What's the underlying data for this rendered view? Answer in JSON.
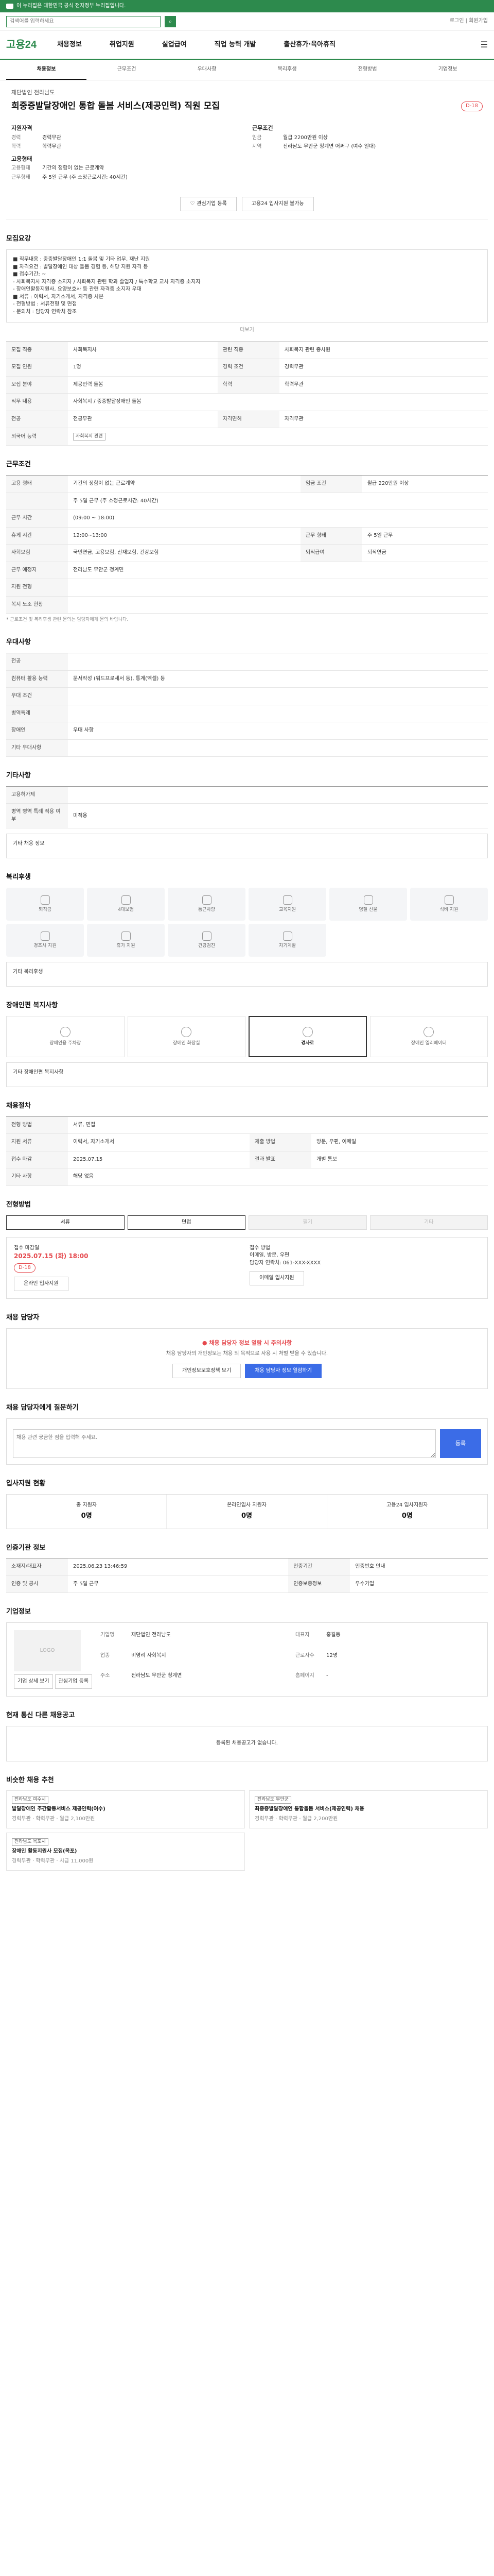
{
  "topbar": {
    "text": "이 누리집은 대한민국 공식 전자정부 누리집입니다."
  },
  "util": {
    "search_placeholder": "검색어를 입력하세요",
    "right": "로그인 | 회원가입"
  },
  "gnb": {
    "logo": "고용24",
    "menu": [
      "채용정보",
      "취업지원",
      "실업급여",
      "직업 능력 개발",
      "출산휴가·육아휴직"
    ]
  },
  "tabs": [
    "채용정보",
    "근무조건",
    "우대사항",
    "복리후생",
    "전형방법",
    "기업정보"
  ],
  "hero": {
    "org": "재단법인 전라남도",
    "title": "희중증발달장애인 통합 돌봄 서비스(제공인력) 직원 모집",
    "dday": "D-18",
    "qualify_h": "지원자격",
    "career_k": "경력",
    "career_v": "경력무관",
    "edu_k": "학력",
    "edu_v": "학력무관",
    "cond_h": "근무조건",
    "pay_k": "임금",
    "pay_v": "월급 2200만원 이상",
    "loc_k": "지역",
    "loc_v": "전라남도 무안군 청계면 어쩌구 (여수 일대)",
    "type_h": "고용형태",
    "type_k": "고용형태",
    "type_v": "기간의 정함이 없는 근로계약",
    "time_k": "근무형태",
    "time_v": "주 5일 근무 (주 소정근로시간: 40시간)",
    "btn_interest": "관심기업 등록",
    "btn_share": "고용24 입사지원 불가능"
  },
  "job_section": {
    "title": "모집요강",
    "body": "■ 직무내용 : 중증발달장애인 1:1 돌봄 및 기타 업무, 재난 지원",
    "lines": [
      "■ 자격요건 : 발달장애인 대상 돌봄 경험 등, 해당 지원 자격 등",
      "■ 접수기간: ~",
      "- 사회복지사 자격증 소지자 / 사회복지 관련 학과 졸업자 / 특수학교 교사 자격증 소지자",
      "- 장애인활동지원사, 요양보호사 등 관련 자격증 소지자 우대",
      "■ 서류 : 이력서, 자기소개서, 자격증 사본",
      "- 전형방법 : 서류전형 및 면접",
      "- 문의처 : 담당자 연락처 참조"
    ],
    "more": "더보기"
  },
  "job_table": [
    {
      "k1": "모집 직종",
      "v1": "사회복지사",
      "k2": "관련 직종",
      "v2": "사회복지 관련 종사원"
    },
    {
      "k1": "모집 인원",
      "v1": "1명",
      "k2": "경력 조건",
      "v2": "경력무관"
    },
    {
      "k1": "모집 분야",
      "v1": "제공인력 돌봄",
      "k2": "학력",
      "v2": "학력무관"
    },
    {
      "k1": "직무 내용",
      "v1": "사회복지 / 중증발달장애인 돌봄",
      "k2": "",
      "v2": ""
    },
    {
      "k1": "전공",
      "v1": "전공무관",
      "k2": "자격면허",
      "v2": "자격무관"
    },
    {
      "k1": "외국어 능력",
      "v1": "",
      "k2": "",
      "v2": ""
    }
  ],
  "job_tag": "사회복지 관련",
  "work_section": {
    "title": "근무조건"
  },
  "work_table": [
    {
      "k1": "고용 형태",
      "v1": "기간의 정함이 없는 근로계약",
      "k2": "임금 조건",
      "v2": "월급 220만원 이상"
    },
    {
      "k1": "",
      "v1": "주 5일 근무 (주 소정근로시간: 40시간)",
      "k2": "",
      "v2": ""
    },
    {
      "k1": "근무 시간",
      "v1": "(09:00 ~ 18:00)",
      "k2": "",
      "v2": ""
    },
    {
      "k1": "휴게 시간",
      "v1": "12:00~13:00",
      "k2": "근무 형태",
      "v2": "주 5일 근무"
    },
    {
      "k1": "사회보험",
      "v1": "국민연금, 고용보험, 산재보험, 건강보험",
      "k2": "퇴직급여",
      "v2": "퇴직연금"
    },
    {
      "k1": "근무 예정지",
      "v1": "전라남도 무안군 청계면",
      "k2": "",
      "v2": ""
    },
    {
      "k1": "지원 전형",
      "v1": "",
      "k2": "",
      "v2": ""
    },
    {
      "k1": "복지 노조 현황",
      "v1": "",
      "k2": "",
      "v2": ""
    }
  ],
  "work_note": "* 근로조건 및 복리후생 관련 문의는 담당자에게 문의 바랍니다.",
  "pref_section": {
    "title": "우대사항"
  },
  "pref_table": [
    {
      "k": "전공",
      "v": ""
    },
    {
      "k": "컴퓨터 활용 능력",
      "v": "문서작성 (워드프로세서 등), 통계(엑셀) 등"
    },
    {
      "k": "우대 조건",
      "v": ""
    },
    {
      "k": "병역특례",
      "v": ""
    },
    {
      "k": "장애인",
      "v": "우대 사항"
    },
    {
      "k": "기타 우대사항",
      "v": ""
    }
  ],
  "other_section": {
    "title": "기타사항"
  },
  "other_table": [
    {
      "k": "고용허가제",
      "v": ""
    },
    {
      "k": "병역 병역 특례 적용 여부",
      "v": "미적용"
    }
  ],
  "other_note": "기타 채용 정보",
  "welfare_section": {
    "title": "복리후생"
  },
  "welfare": [
    "퇴직금",
    "4대보험",
    "통근차량",
    "교육지원",
    "명절 선물",
    "식비 지원",
    "경조사 지원",
    "휴가 지원",
    "건강검진",
    "자기계발"
  ],
  "welfare_note": "기타 복리후생",
  "disability_section": {
    "title": "장애인편 복지사항"
  },
  "disability": [
    "장애인용 주차장",
    "장애인 화장실",
    "경사로",
    "장애인 엘리베이터"
  ],
  "disability_note": "기타 장애인편 복지사항",
  "recruit_section": {
    "title": "채용절차"
  },
  "recruit_table": [
    {
      "k1": "전형 방법",
      "v1": "서류, 면접",
      "k2": "",
      "v2": ""
    },
    {
      "k1": "지원 서류",
      "v1": "이력서, 자기소개서",
      "k2": "제출 방법",
      "v2": "방문, 우편, 이메일"
    },
    {
      "k1": "접수 마감",
      "v1": "2025.07.15",
      "k2": "결과 발표",
      "v2": "개별 통보"
    },
    {
      "k1": "기타 사항",
      "v1": "해당 없음",
      "k2": "",
      "v2": ""
    }
  ],
  "method_section": {
    "title": "전형방법"
  },
  "methods": [
    "서류",
    "면접",
    "필기",
    "기타"
  ],
  "apply": {
    "h1": "접수 마감일",
    "deadline": "2025.07.15 (화) 18:00",
    "dday": "D-18",
    "h2": "접수 방법",
    "method": "이메일, 방문, 우편",
    "contact": "담당자 연락처: 061-XXX-XXXX",
    "btn1": "온라인 입사지원",
    "btn2": "이메일 입사지원"
  },
  "contact_section": {
    "title": "채용 담당자"
  },
  "contact": {
    "warn": "● 채용 담당자 정보 열람 시 주의사항",
    "p": "채용 담당자의 개인정보는 채용 외 목적으로 사용 시 처벌 받을 수 있습니다.",
    "btn1": "개인정보보호정책 보기",
    "btn2": "채용 담당자 정보 열람하기"
  },
  "qa_section": {
    "title": "채용 담당자에게 질문하기"
  },
  "qa": {
    "placeholder": "채용 관련 궁금한 점을 입력해 주세요.",
    "send": "등록"
  },
  "stats_section": {
    "title": "입사지원 현황"
  },
  "stats": [
    {
      "label": "총 지원자",
      "value": "0명"
    },
    {
      "label": "온라인입사 지원자",
      "value": "0명"
    },
    {
      "label": "고용24 입사지원자",
      "value": "0명"
    }
  ],
  "agency_section": {
    "title": "인증기관 정보"
  },
  "agency_table": [
    {
      "k1": "소재지/대표자",
      "v1": "2025.06.23 13:46:59",
      "k2": "인증기간",
      "v2": "인증번호 안내"
    },
    {
      "k1": "인증 및 공시",
      "v1": "주 5일 근무",
      "k2": "인증보증정보",
      "v2": "우수기업"
    }
  ],
  "company_section": {
    "title": "기업정보"
  },
  "company": {
    "logo": "LOGO",
    "name_k": "기업명",
    "name_v": "재단법인 전라남도",
    "ceo_k": "대표자",
    "ceo_v": "홍길동",
    "type_k": "업종",
    "type_v": "비영리 사회복지",
    "emp_k": "근로자수",
    "emp_v": "12명",
    "addr_k": "주소",
    "addr_v": "전라남도 무안군 청계면",
    "site_k": "홈페이지",
    "site_v": "-",
    "btn1": "기업 상세 보기",
    "btn2": "관심기업 등록"
  },
  "similar_section": {
    "title": "현재 통신 다른 채용공고",
    "empty": "등록된 채용공고가 없습니다."
  },
  "rec_section": {
    "title": "비슷한 채용 추천"
  },
  "recs": [
    {
      "tag": "전라남도 여수시",
      "title": "발달장애인 주간활동서비스 제공인력(여수)",
      "meta": "경력무관 · 학력무관 · 월급 2,100만원"
    },
    {
      "tag": "전라남도 무안군",
      "title": "최중증발달장애인 통합돌봄 서비스(제공인력) 채용",
      "meta": "경력무관 · 학력무관 · 월급 2,200만원"
    },
    {
      "tag": "전라남도 목포시",
      "title": "장애인 활동지원사 모집(목포)",
      "meta": "경력무관 · 학력무관 · 시급 11,000원"
    }
  ]
}
